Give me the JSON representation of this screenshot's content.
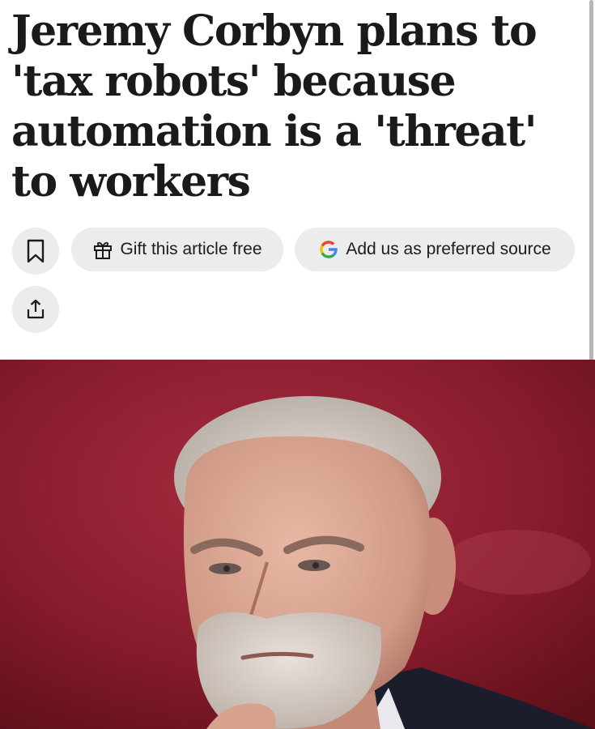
{
  "article": {
    "headline": "Jeremy Corbyn plans to 'tax robots' because automation is a 'threat' to workers"
  },
  "actions": {
    "bookmark_icon": "bookmark-icon",
    "gift_icon": "gift-icon",
    "gift_label": "Gift this article free",
    "source_icon": "google-icon",
    "source_label": "Add us as preferred source",
    "share_icon": "share-icon"
  },
  "colors": {
    "button_bg": "#ececec",
    "photo_background": "#8a1d2d",
    "text": "#1a1a1a"
  }
}
